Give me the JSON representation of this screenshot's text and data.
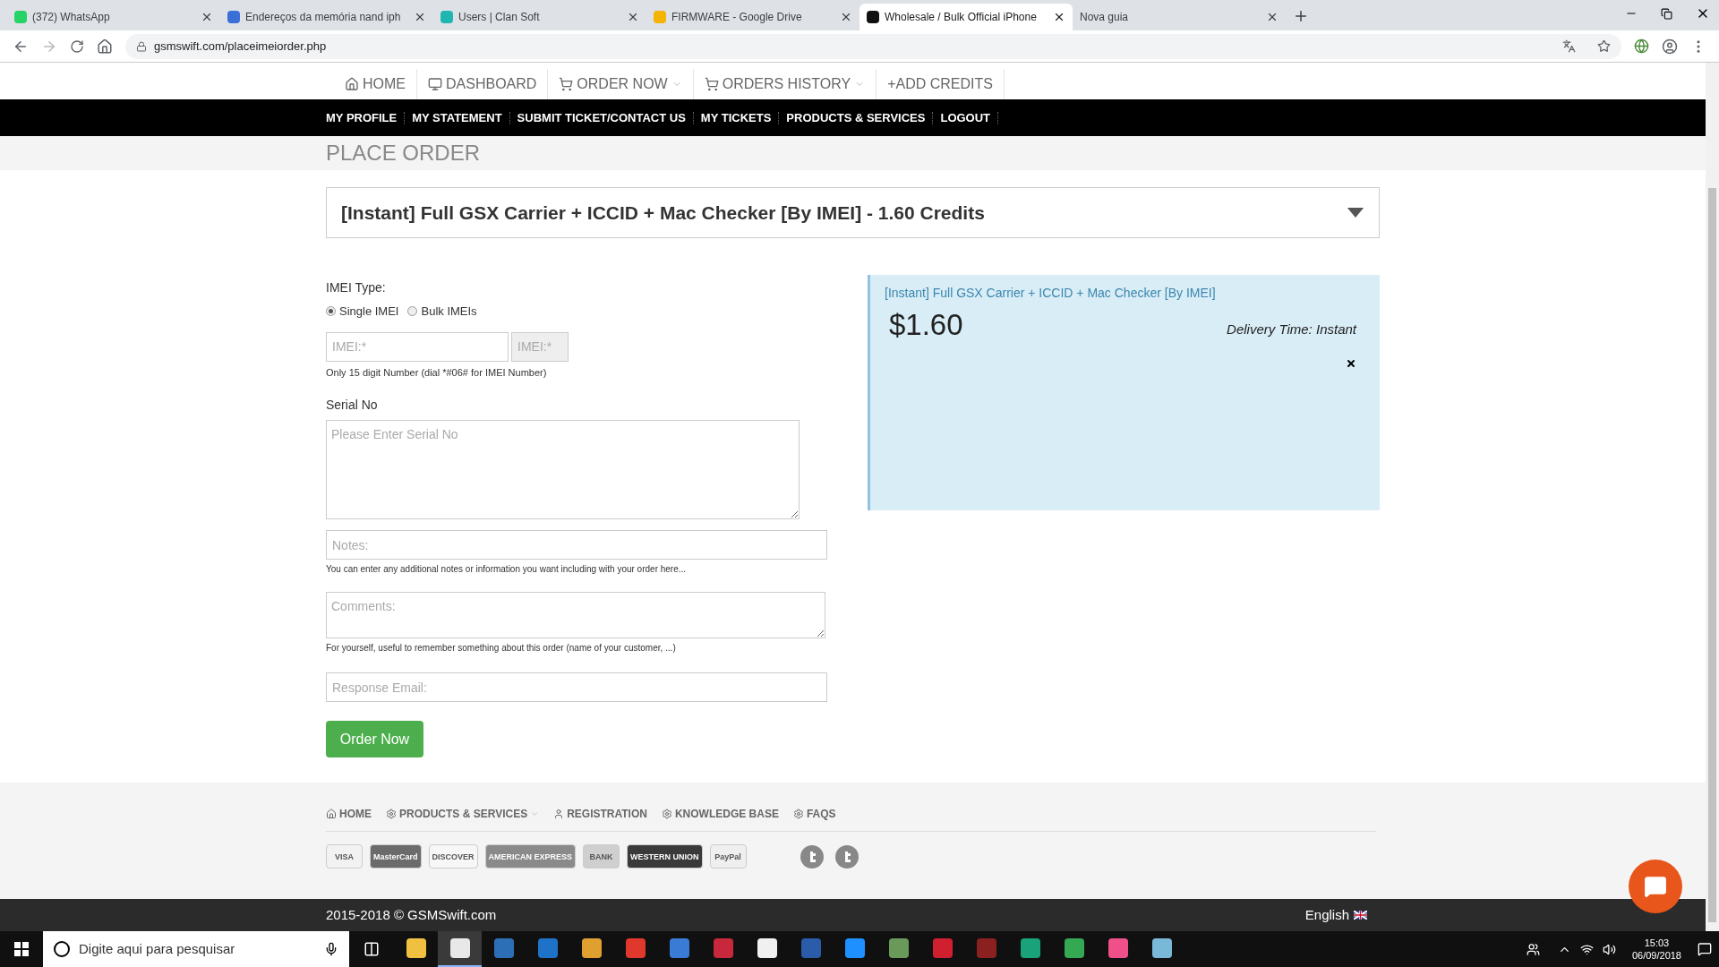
{
  "browser": {
    "tabs": [
      {
        "title": "(372) WhatsApp",
        "selected": false,
        "color": "#25d366"
      },
      {
        "title": "Endereços da memória nand iph",
        "selected": false,
        "color": "#3b6fd8"
      },
      {
        "title": "Users | Clan Soft",
        "selected": false,
        "color": "#1fb5b0"
      },
      {
        "title": "FIRMWARE - Google Drive",
        "selected": false,
        "color": "#f4b400"
      },
      {
        "title": "Wholesale / Bulk Official iPhone",
        "selected": true,
        "color": "#111111"
      },
      {
        "title": "Nova guia",
        "selected": false
      }
    ],
    "address": "gsmswift.com/placeimeiorder.php"
  },
  "nav": {
    "items": [
      {
        "label": "HOME",
        "kind": "home",
        "dropdown": false
      },
      {
        "label": "DASHBOARD",
        "kind": "monitor",
        "dropdown": false
      },
      {
        "label": "ORDER NOW",
        "kind": "cart",
        "dropdown": true
      },
      {
        "label": "ORDERS HISTORY",
        "kind": "cart",
        "dropdown": true
      },
      {
        "label": "+ADD CREDITS",
        "kind": "plain",
        "dropdown": false
      }
    ]
  },
  "subnav": {
    "items": [
      "MY PROFILE",
      "MY STATEMENT",
      "SUBMIT TICKET/CONTACT US",
      "MY TICKETS",
      "PRODUCTS & SERVICES",
      "LOGOUT"
    ]
  },
  "page_title": "PLACE ORDER",
  "service_select": {
    "value": "[Instant] Full GSX Carrier + ICCID + Mac Checker [By IMEI] - 1.60 Credits"
  },
  "form": {
    "imei_type": {
      "label": "IMEI Type:",
      "options": [
        {
          "label": "Single IMEI",
          "selected": true
        },
        {
          "label": "Bulk IMEIs",
          "selected": false
        }
      ]
    },
    "imei_fields": [
      {
        "placeholder": "IMEI:*",
        "disabled": false
      },
      {
        "placeholder": "IMEI:*",
        "disabled": true
      }
    ],
    "imei_hint": "Only 15 digit Number (dial *#06# for IMEI Number)",
    "serial_label": "Serial No",
    "serial": {
      "placeholder": "Please Enter Serial No"
    },
    "notes": {
      "placeholder": "Notes:"
    },
    "notes_hint": "You can enter any additional notes or information you want including with your order here...",
    "comments": {
      "placeholder": "Comments:"
    },
    "comments_hint": "For yourself, useful to remember something about this order (name of your customer, ...)",
    "email": {
      "placeholder": "Response Email:"
    },
    "submit": "Order Now"
  },
  "info_panel": {
    "title": "[Instant] Full GSX Carrier + ICCID + Mac Checker [By IMEI]",
    "price": "$1.60",
    "delivery": "Delivery Time: Instant"
  },
  "footer": {
    "links": [
      {
        "label": "HOME",
        "kind": "home",
        "dropdown": false
      },
      {
        "label": "PRODUCTS & SERVICES",
        "kind": "cog",
        "dropdown": true
      },
      {
        "label": "REGISTRATION",
        "kind": "user",
        "dropdown": false
      },
      {
        "label": "KNOWLEDGE BASE",
        "kind": "cog",
        "dropdown": false
      },
      {
        "label": "FAQS",
        "kind": "cog",
        "dropdown": false
      }
    ],
    "payment_methods": [
      {
        "label": "VISA",
        "color": "#f2f2f2"
      },
      {
        "label": "MasterCard",
        "color": "#6b6b6b"
      },
      {
        "label": "DISCOVER",
        "color": "#f7f7f7"
      },
      {
        "label": "AMERICAN EXPRESS",
        "color": "#8a8a8a"
      },
      {
        "label": "BANK",
        "color": "#cfcfcf"
      },
      {
        "label": "WESTERN UNION",
        "color": "#3a3a3a"
      },
      {
        "label": "PayPal",
        "color": "#efefef"
      }
    ],
    "copyright": "2015-2018 © GSMSwift.com",
    "language": "English"
  },
  "taskbar": {
    "search_placeholder": "Digite aqui para pesquisar",
    "time": "15:03",
    "date": "06/09/2018",
    "apps": [
      {
        "color": "#f0c040",
        "active": false
      },
      {
        "color": "#e8e8e8",
        "active": true
      },
      {
        "color": "#2d6fb7",
        "active": false
      },
      {
        "color": "#1e73c8",
        "active": false
      },
      {
        "color": "#e0a030",
        "active": false
      },
      {
        "color": "#e0382c",
        "active": false
      },
      {
        "color": "#3a7bd5",
        "active": false
      },
      {
        "color": "#c8283c",
        "active": false
      },
      {
        "color": "#f0f0f0",
        "active": false
      },
      {
        "color": "#2a5caa",
        "active": false
      },
      {
        "color": "#1e90ff",
        "active": false
      },
      {
        "color": "#6a9a5a",
        "active": false
      },
      {
        "color": "#d02030",
        "active": false
      },
      {
        "color": "#8a2020",
        "active": false
      },
      {
        "color": "#1aa37a",
        "active": false
      },
      {
        "color": "#34a853",
        "active": false
      },
      {
        "color": "#f0508a",
        "active": false
      },
      {
        "color": "#7ab8d8",
        "active": false
      }
    ]
  }
}
